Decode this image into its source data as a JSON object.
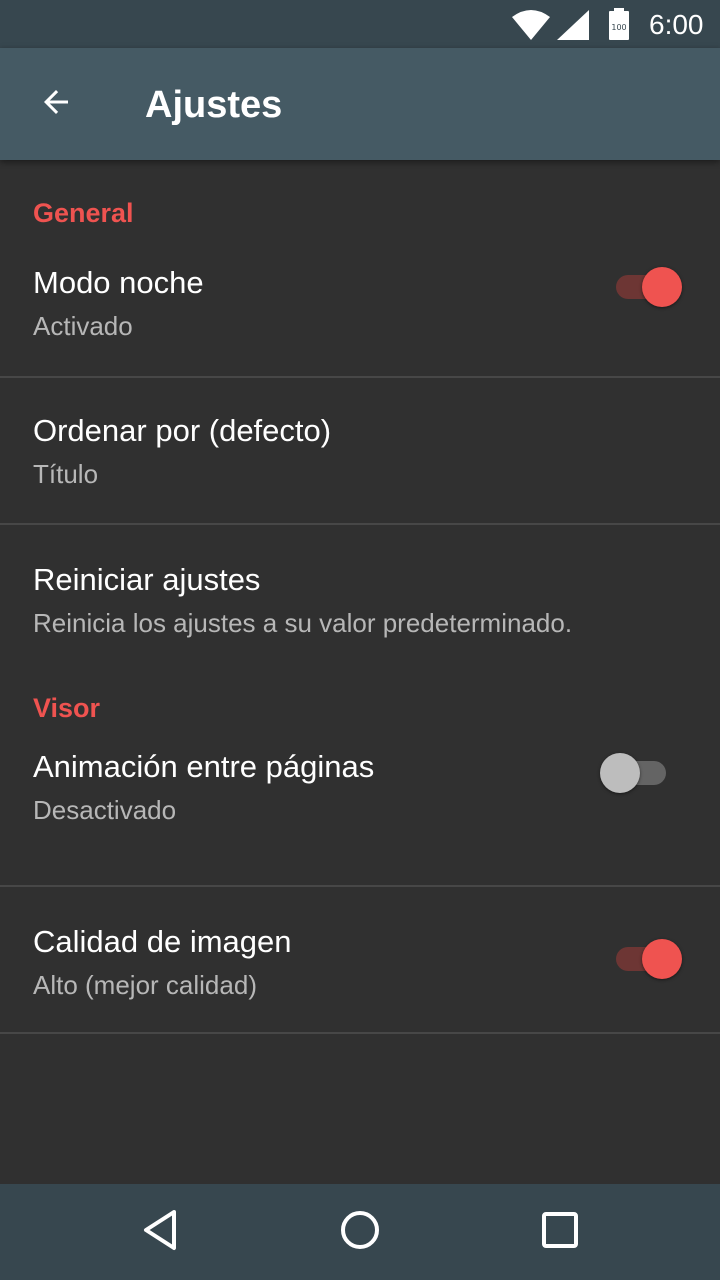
{
  "status_bar": {
    "time": "6:00",
    "battery_level": "100"
  },
  "app_bar": {
    "title": "Ajustes",
    "back_icon": "arrow-back-icon"
  },
  "colors": {
    "accent": "#ef5350",
    "background": "#303030",
    "app_bar": "#455a64",
    "status_bar": "#37474f",
    "divider": "#474747",
    "subtitle": "#b7b7b7"
  },
  "sections": [
    {
      "header": "General",
      "items": [
        {
          "title": "Modo noche",
          "subtitle": "Activado",
          "toggle": true
        },
        {
          "title": "Ordenar por (defecto)",
          "subtitle": "Título"
        },
        {
          "title": "Reiniciar ajustes",
          "subtitle": "Reinicia los ajustes a su valor predeterminado."
        }
      ]
    },
    {
      "header": "Visor",
      "items": [
        {
          "title": "Animación entre páginas",
          "subtitle": "Desactivado",
          "toggle": false
        },
        {
          "title": "Calidad de imagen",
          "subtitle": "Alto (mejor calidad)",
          "toggle": true
        }
      ]
    }
  ],
  "nav_bar": {
    "icons": [
      "back-triangle-icon",
      "home-circle-icon",
      "recents-square-icon"
    ]
  }
}
